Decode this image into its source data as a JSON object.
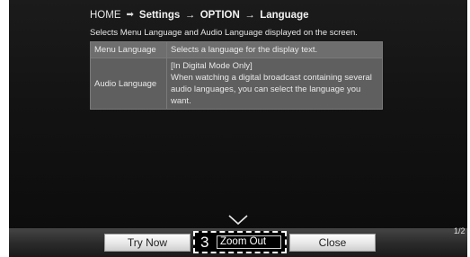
{
  "breadcrumb": {
    "home": "HOME",
    "settings": "Settings",
    "option": "OPTION",
    "language": "Language"
  },
  "description": "Selects Menu Language and Audio Language displayed on the screen.",
  "table": {
    "rows": [
      {
        "name": "Menu Language",
        "lines": [
          "Selects a language for the display text."
        ]
      },
      {
        "name": "Audio Language",
        "lines": [
          "[In Digital Mode Only]",
          "When watching a digital broadcast containing several",
          "audio languages, you can select the language you want."
        ]
      }
    ]
  },
  "page_indicator": "1/2",
  "buttons": {
    "try_now": "Try Now",
    "zoom_number": "3",
    "zoom_out": "Zoom Out",
    "close": "Close"
  },
  "icons": {
    "home_arrow": "arrow-right-icon",
    "scroll_down": "chevron-down-icon"
  },
  "colors": {
    "background": "#121212",
    "table_cell": "#6e6e6e",
    "button_face": "#e9e9e9",
    "focus_outline": "#ffffff"
  }
}
